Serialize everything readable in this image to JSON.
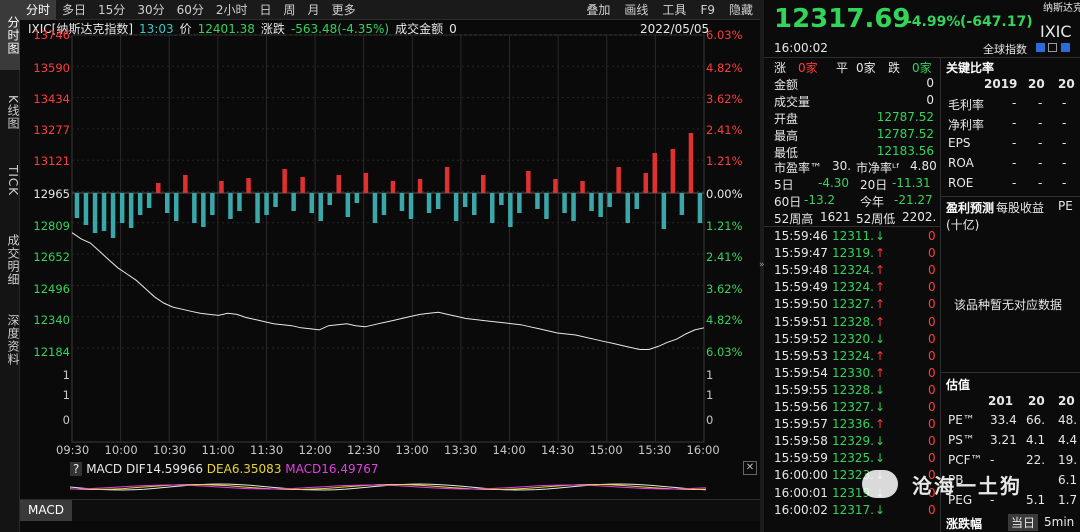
{
  "sidebar": {
    "items": [
      {
        "label": "分时图"
      },
      {
        "label": "K线图"
      },
      {
        "label": "TICK"
      },
      {
        "label": "成交明细"
      },
      {
        "label": "深度资料"
      }
    ]
  },
  "topbar": {
    "tabs": [
      "分时",
      "多日",
      "15分",
      "30分",
      "60分",
      "2小时",
      "日",
      "周",
      "月",
      "更多"
    ],
    "tools": [
      "叠加",
      "画线",
      "工具",
      "F9",
      "隐藏"
    ]
  },
  "infobar": {
    "name": "IXIC[纳斯达克指数]",
    "time": "13:03",
    "price_label": "价",
    "price": "12401.38",
    "change_label": "涨跌",
    "change": "-563.48(-4.35%)",
    "amount_label": "成交金额",
    "amount": "0",
    "date": "2022/05/05"
  },
  "chart_data": {
    "type": "line",
    "y_left_ticks": [
      "13746",
      "13590",
      "13434",
      "13277",
      "13121",
      "12965",
      "12809",
      "12652",
      "12496",
      "12340",
      "12184",
      "1",
      "1",
      "0"
    ],
    "y_right_ticks": [
      "6.03%",
      "4.82%",
      "3.62%",
      "2.41%",
      "1.21%",
      "0.00%",
      "1.21%",
      "2.41%",
      "3.62%",
      "4.82%",
      "6.03%",
      "1",
      "1",
      "0"
    ],
    "x_ticks": [
      "09:30",
      "10:00",
      "10:30",
      "11:00",
      "11:30",
      "12:00",
      "12:30",
      "13:00",
      "13:30",
      "14:00",
      "14:30",
      "15:00",
      "15:30",
      "16:00"
    ],
    "reference_price": 12965,
    "ylim": [
      12184,
      13746
    ],
    "price_series": [
      12790,
      12760,
      12740,
      12700,
      12660,
      12620,
      12590,
      12560,
      12520,
      12480,
      12450,
      12430,
      12420,
      12410,
      12400,
      12395,
      12390,
      12400,
      12395,
      12380,
      12370,
      12360,
      12350,
      12345,
      12340,
      12330,
      12325,
      12320,
      12340,
      12345,
      12350,
      12340,
      12335,
      12345,
      12355,
      12365,
      12375,
      12385,
      12395,
      12400,
      12405,
      12395,
      12385,
      12375,
      12370,
      12365,
      12360,
      12355,
      12350,
      12345,
      12335,
      12325,
      12315,
      12305,
      12300,
      12295,
      12285,
      12275,
      12265,
      12255,
      12245,
      12235,
      12225,
      12225,
      12240,
      12260,
      12275,
      12300,
      12320,
      12330
    ],
    "bar_series": [
      -25,
      -32,
      -40,
      -38,
      -45,
      -30,
      -35,
      -22,
      -15,
      10,
      -20,
      -28,
      18,
      -30,
      -34,
      -22,
      12,
      -26,
      -18,
      15,
      -30,
      -22,
      -14,
      24,
      -18,
      16,
      -20,
      -28,
      -12,
      18,
      -24,
      -10,
      20,
      -30,
      -22,
      12,
      -18,
      -26,
      14,
      -20,
      -16,
      26,
      -28,
      -14,
      -22,
      18,
      -30,
      -12,
      -34,
      -20,
      22,
      -16,
      -26,
      14,
      -20,
      -28,
      12,
      -18,
      -24,
      -14,
      26,
      -30,
      -16,
      20,
      40,
      -36,
      44,
      -22,
      60,
      -30
    ]
  },
  "macd": {
    "help": "?",
    "label": "MACD",
    "dif_label": "DIF",
    "dif": "14.59966",
    "dea_label": "DEA",
    "dea": "6.35083",
    "macd_label": "MACD",
    "macd_value": "16.49767",
    "close": "✕",
    "tab": "MACD"
  },
  "quote": {
    "price": "12317.69",
    "change": "-4.99%",
    "change_abs": "(-647.17)",
    "name_cn": "纳斯达克指数",
    "code": "IXIC",
    "time": "16:00:02",
    "category": "全球指数"
  },
  "stats": {
    "zhang_label": "涨",
    "zhang": "0家",
    "ping_label": "平",
    "ping": "0家",
    "die_label": "跌",
    "die": "0家",
    "rows": [
      {
        "label": "金额",
        "value": "0",
        "color": "#e8e8e8"
      },
      {
        "label": "成交量",
        "value": "0",
        "color": "#e8e8e8"
      },
      {
        "label": "开盘",
        "value": "12787.52",
        "color": "#33d45a"
      },
      {
        "label": "最高",
        "value": "12787.52",
        "color": "#33d45a"
      },
      {
        "label": "最低",
        "value": "12183.56",
        "color": "#33d45a"
      }
    ],
    "pe_label": "市盈率™",
    "pe": "30.",
    "pb_label": "市净率ᴸᶠ",
    "pb": "4.80",
    "d5_label": "5日",
    "d5": "-4.30",
    "d20_label": "20日",
    "d20": "-11.31",
    "d60_label": "60日",
    "d60": "-13.2",
    "ytd_label": "今年",
    "ytd": "-21.27",
    "hi52_label": "52周高",
    "hi52": "1621",
    "lo52_label": "52周低",
    "lo52": "2202."
  },
  "ticks": [
    {
      "time": "15:59:46",
      "price": "12311.",
      "dir": "↓",
      "vol": "0"
    },
    {
      "time": "15:59:47",
      "price": "12319.",
      "dir": "↑",
      "vol": "0"
    },
    {
      "time": "15:59:48",
      "price": "12324.",
      "dir": "↑",
      "vol": "0"
    },
    {
      "time": "15:59:49",
      "price": "12324.",
      "dir": "↑",
      "vol": "0"
    },
    {
      "time": "15:59:50",
      "price": "12327.",
      "dir": "↑",
      "vol": "0"
    },
    {
      "time": "15:59:51",
      "price": "12328.",
      "dir": "↑",
      "vol": "0"
    },
    {
      "time": "15:59:52",
      "price": "12320.",
      "dir": "↓",
      "vol": "0"
    },
    {
      "time": "15:59:53",
      "price": "12324.",
      "dir": "↑",
      "vol": "0"
    },
    {
      "time": "15:59:54",
      "price": "12330.",
      "dir": "↑",
      "vol": "0"
    },
    {
      "time": "15:59:55",
      "price": "12328.",
      "dir": "↓",
      "vol": "0"
    },
    {
      "time": "15:59:56",
      "price": "12327.",
      "dir": "↓",
      "vol": "0"
    },
    {
      "time": "15:59:57",
      "price": "12336.",
      "dir": "↑",
      "vol": "0"
    },
    {
      "time": "15:59:58",
      "price": "12329.",
      "dir": "↓",
      "vol": "0"
    },
    {
      "time": "15:59:59",
      "price": "12325.",
      "dir": "↓",
      "vol": "0"
    },
    {
      "time": "16:00:00",
      "price": "12323.",
      "dir": "↓",
      "vol": "0"
    },
    {
      "time": "16:00:01",
      "price": "12319.",
      "dir": "↓",
      "vol": "0"
    },
    {
      "time": "16:00:02",
      "price": "12317.",
      "dir": "↓",
      "vol": "0"
    }
  ],
  "ratios": {
    "title": "关键比率",
    "col1": "2019",
    "col2": "20",
    "col3": "20",
    "rows": [
      {
        "label": "毛利率",
        "v1": "-",
        "v2": "-",
        "v3": "-"
      },
      {
        "label": "净利率",
        "v1": "-",
        "v2": "-",
        "v3": "-"
      },
      {
        "label": "EPS",
        "v1": "-",
        "v2": "-",
        "v3": "-"
      },
      {
        "label": "ROA",
        "v1": "-",
        "v2": "-",
        "v3": "-"
      },
      {
        "label": "ROE",
        "v1": "-",
        "v2": "-",
        "v3": "-"
      }
    ]
  },
  "forecast": {
    "title": "盈利预测",
    "subtitle": "每股收益",
    "pe": "PE",
    "unit": "(十亿)",
    "empty": "该品种暂无对应数据"
  },
  "valuation": {
    "title": "估值",
    "col1": "201",
    "col2": "20",
    "col3": "20",
    "rows": [
      {
        "label": "PE™",
        "v1": "33.4",
        "v2": "66.",
        "v3": "48."
      },
      {
        "label": "PS™",
        "v1": "3.21",
        "v2": "4.1",
        "v3": "4.4"
      },
      {
        "label": "PCF™",
        "v1": "-",
        "v2": "22.",
        "v3": "19."
      },
      {
        "label": "PB",
        "v1": "",
        "v2": "",
        "v3": "6.1"
      },
      {
        "label": "PEG",
        "v1": "-",
        "v2": "5.1",
        "v3": "1.7"
      }
    ],
    "range_label": "涨跌幅",
    "range_tabs": [
      "当日",
      "5min"
    ]
  },
  "watermark": "沧海一土狗"
}
